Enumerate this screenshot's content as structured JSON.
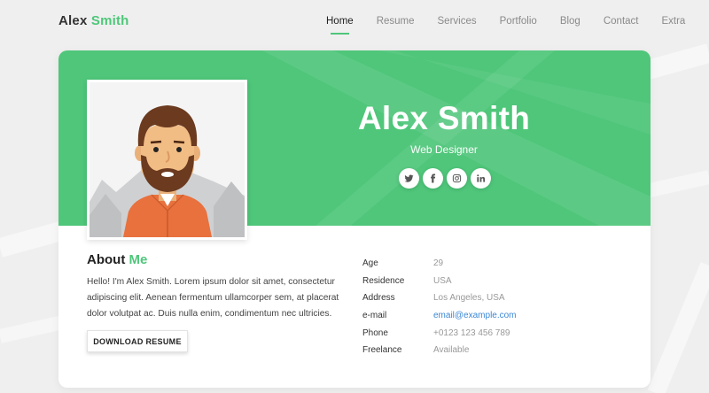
{
  "header": {
    "logo_first": "Alex",
    "logo_second": "Smith",
    "nav": [
      "Home",
      "Resume",
      "Services",
      "Portfolio",
      "Blog",
      "Contact",
      "Extra"
    ]
  },
  "profile": {
    "name": "Alex Smith",
    "role": "Web Designer",
    "socials": [
      "twitter-icon",
      "facebook-icon",
      "instagram-icon",
      "linkedin-icon"
    ]
  },
  "about": {
    "title_first": "About",
    "title_second": "Me",
    "text": "Hello! I'm Alex Smith. Lorem ipsum dolor sit amet, consectetur adipiscing elit. Aenean fermentum ullamcorper sem, at placerat dolor volutpat ac. Duis nulla enim, condimentum nec ultricies.",
    "download_label": "DOWNLOAD RESUME"
  },
  "info": [
    {
      "label": "Age",
      "value": "29"
    },
    {
      "label": "Residence",
      "value": "USA"
    },
    {
      "label": "Address",
      "value": "Los Angeles, USA"
    },
    {
      "label": "e-mail",
      "value": "email@example.com"
    },
    {
      "label": "Phone",
      "value": "+0123 123 456 789"
    },
    {
      "label": "Freelance",
      "value": "Available"
    }
  ],
  "colors": {
    "accent": "#4fc67a",
    "link": "#3b87d6",
    "background": "#efefef"
  }
}
